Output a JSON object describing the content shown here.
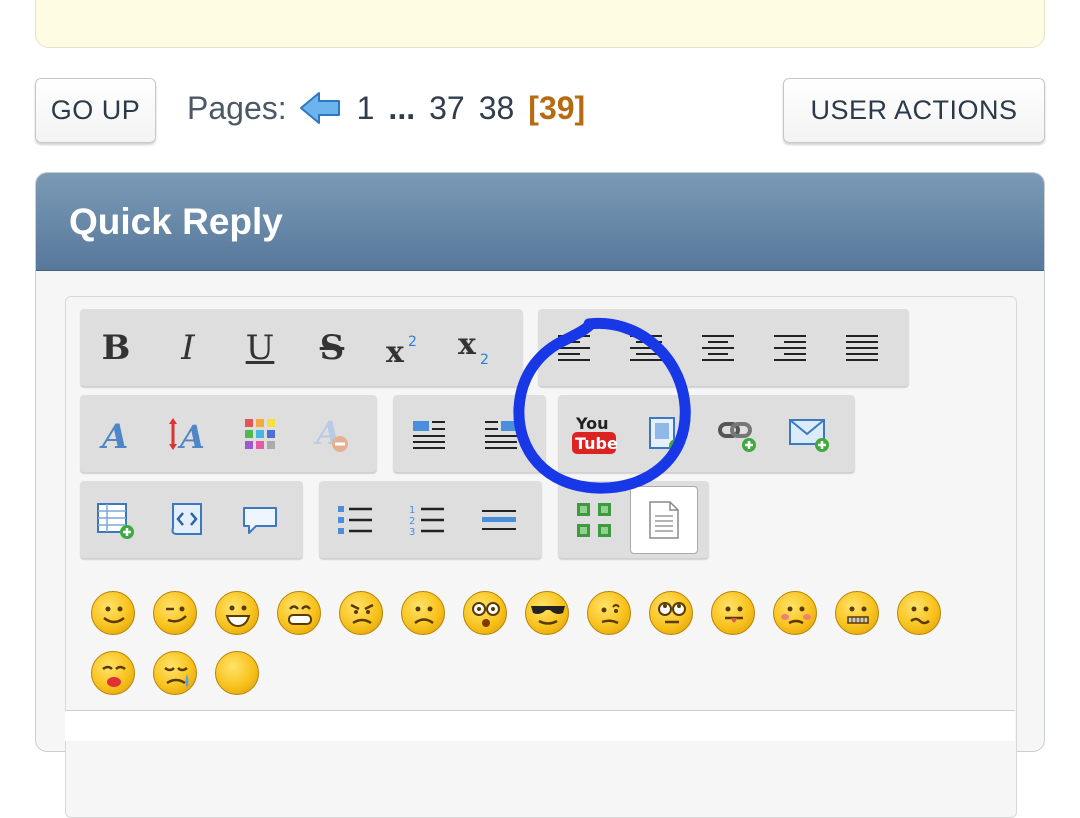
{
  "nav": {
    "go_up": "GO UP",
    "pages_label": "Pages:",
    "pages": [
      "1",
      "...",
      "37",
      "38"
    ],
    "current_page": "[39]",
    "user_actions": "USER ACTIONS"
  },
  "quick_reply": {
    "title": "Quick Reply",
    "toolbar_row1": [
      "bold",
      "italic",
      "underline",
      "strikethrough",
      "superscript",
      "subscript",
      "align-left",
      "align-justify-left",
      "align-center",
      "align-right",
      "align-justify"
    ],
    "toolbar_row2": [
      "font-face",
      "font-size",
      "font-color",
      "remove-format",
      "float-left",
      "float-right",
      "youtube",
      "insert-image",
      "insert-link",
      "insert-email"
    ],
    "toolbar_row3": [
      "insert-table",
      "insert-code",
      "insert-quote",
      "bulleted-list",
      "numbered-list",
      "horizontal-rule",
      "toggle-preview",
      "source-mode"
    ],
    "bold_label": "B",
    "italic_label": "I",
    "underline_label": "U",
    "strike_label": "S",
    "youtube_top": "You",
    "youtube_bottom": "Tube"
  },
  "smileys": [
    "smiley",
    "wink",
    "cheesy",
    "grin",
    "angry",
    "sad",
    "shocked",
    "cool",
    "huh",
    "rolleyes",
    "tongue",
    "embarrassed",
    "lipsrsealed",
    "undecided",
    "kiss",
    "cry",
    "blank"
  ],
  "colors": {
    "header": "#6a8aa8",
    "current_page": "#b66b10",
    "annotation": "#1838e8"
  }
}
